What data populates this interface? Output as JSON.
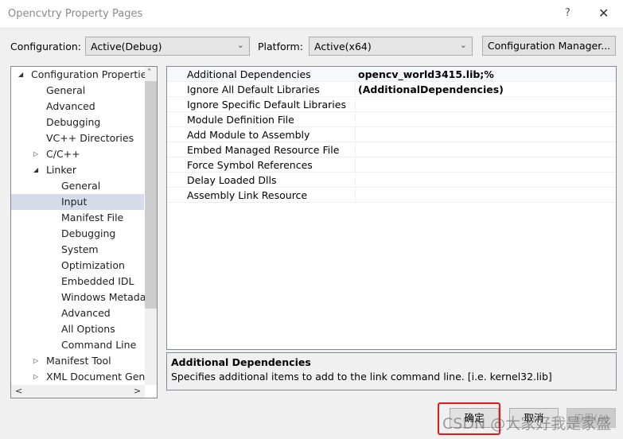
{
  "window": {
    "title": "Opencvtry Property Pages",
    "help": "?",
    "close": "✕"
  },
  "config": {
    "label": "Configuration:",
    "value": "Active(Debug)"
  },
  "platform": {
    "label": "Platform:",
    "value": "Active(x64)"
  },
  "config_manager": "Configuration Manager...",
  "tree": [
    {
      "label": "Configuration Properties",
      "level": 0,
      "twisty": "expanded"
    },
    {
      "label": "General",
      "level": 1
    },
    {
      "label": "Advanced",
      "level": 1
    },
    {
      "label": "Debugging",
      "level": 1
    },
    {
      "label": "VC++ Directories",
      "level": 1
    },
    {
      "label": "C/C++",
      "level": 1,
      "twisty": "collapsed"
    },
    {
      "label": "Linker",
      "level": 1,
      "twisty": "expanded"
    },
    {
      "label": "General",
      "level": 2
    },
    {
      "label": "Input",
      "level": 2,
      "selected": true
    },
    {
      "label": "Manifest File",
      "level": 2
    },
    {
      "label": "Debugging",
      "level": 2
    },
    {
      "label": "System",
      "level": 2
    },
    {
      "label": "Optimization",
      "level": 2
    },
    {
      "label": "Embedded IDL",
      "level": 2
    },
    {
      "label": "Windows Metadata",
      "level": 2
    },
    {
      "label": "Advanced",
      "level": 2
    },
    {
      "label": "All Options",
      "level": 2
    },
    {
      "label": "Command Line",
      "level": 2
    },
    {
      "label": "Manifest Tool",
      "level": 1,
      "twisty": "collapsed"
    },
    {
      "label": "XML Document Generator",
      "level": 1,
      "twisty": "collapsed"
    }
  ],
  "properties": [
    {
      "name": "Additional Dependencies",
      "value": "opencv_world3415.lib;%(AdditionalDependencies)"
    },
    {
      "name": "Ignore All Default Libraries",
      "value": ""
    },
    {
      "name": "Ignore Specific Default Libraries",
      "value": ""
    },
    {
      "name": "Module Definition File",
      "value": ""
    },
    {
      "name": "Add Module to Assembly",
      "value": ""
    },
    {
      "name": "Embed Managed Resource File",
      "value": ""
    },
    {
      "name": "Force Symbol References",
      "value": ""
    },
    {
      "name": "Delay Loaded Dlls",
      "value": ""
    },
    {
      "name": "Assembly Link Resource",
      "value": ""
    }
  ],
  "description": {
    "title": "Additional Dependencies",
    "text": "Specifies additional items to add to the link command line. [i.e. kernel32.lib]"
  },
  "buttons": {
    "ok": "确定",
    "cancel": "取消",
    "apply": "应用(A)"
  },
  "watermark": "CSDN @大家好我是家盛",
  "colors": {
    "highlight": "#e31b1b",
    "selection": "#d6dbe9"
  }
}
